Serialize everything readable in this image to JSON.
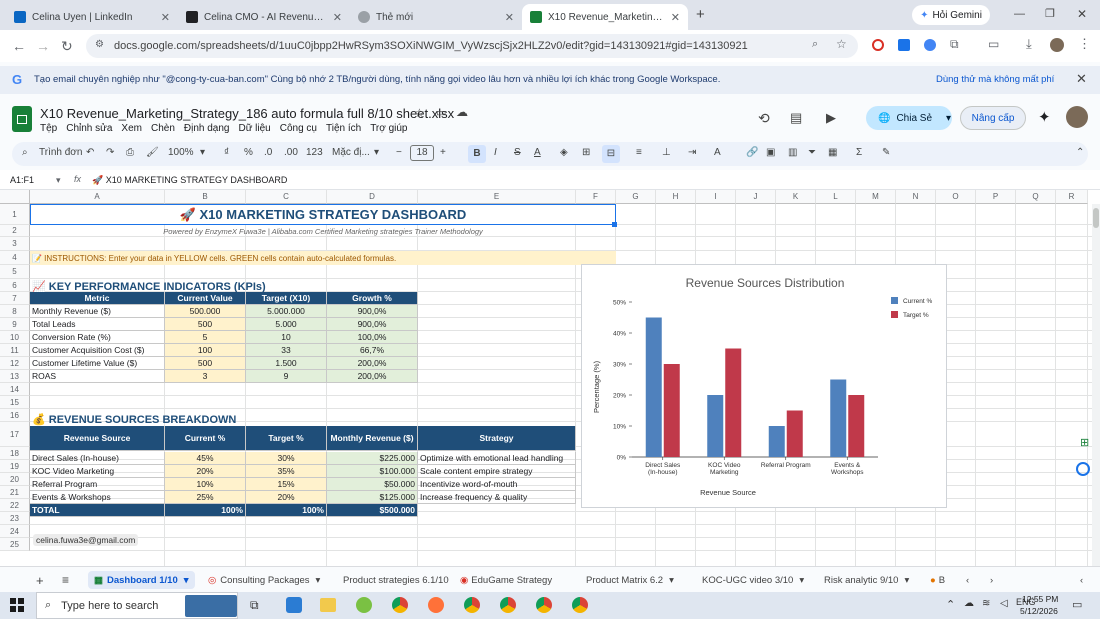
{
  "browser": {
    "tabs": [
      {
        "title": "Celina Uyen | LinkedIn",
        "color": "#0a66c2"
      },
      {
        "title": "Celina CMO - AI Revenue AI | G",
        "color": "#202124"
      },
      {
        "title": "Thẻ mới",
        "color": "#5f6368"
      },
      {
        "title": "X10 Revenue_Marketing_Strate",
        "color": "#188038"
      }
    ],
    "new_tab": "+",
    "gemini_label": "Hỏi Gemini",
    "url": "docs.google.com/spreadsheets/d/1uuC0jbpp2HwRSym3SOXiNWGIM_VyWzscjSjx2HLZ2v0/edit?gid=143130921#gid=143130921"
  },
  "promo": {
    "text": "Tạo email chuyên nghiệp như \"@cong-ty-cua-ban.com\" Cùng bộ nhớ 2 TB/người dùng, tính năng gọi video lâu hơn và nhiều lợi ích khác trong Google Workspace.",
    "cta": "Dùng thử mà không mất phí"
  },
  "doc": {
    "title": "X10 Revenue_Marketing_Strategy_186 auto formula full 8/10 sheet.xlsx",
    "menus": [
      "Tệp",
      "Chỉnh sửa",
      "Xem",
      "Chèn",
      "Định dạng",
      "Dữ liệu",
      "Công cụ",
      "Tiện ích",
      "Trợ giúp"
    ],
    "share_label": "Chia Sẻ",
    "upgrade_label": "Nâng cấp"
  },
  "toolbar": {
    "search": "Trình đơn",
    "zoom": "100%",
    "currency": "₫",
    "percent": "%",
    "dec_less": ".0",
    "dec_more": ".00",
    "numfmt": "123",
    "font": "Mặc đị...",
    "font_size": "18"
  },
  "formula_bar": {
    "cell_ref": "A1:F1",
    "fx": "fx",
    "content": "🚀 X10 MARKETING STRATEGY DASHBOARD"
  },
  "columns": [
    "A",
    "B",
    "C",
    "D",
    "E",
    "F",
    "G",
    "H",
    "I",
    "J",
    "K",
    "L",
    "M",
    "N",
    "O",
    "P",
    "Q",
    "R"
  ],
  "rows": [
    "1",
    "2",
    "3",
    "4",
    "5",
    "6",
    "7",
    "8",
    "9",
    "10",
    "11",
    "12",
    "13",
    "14",
    "15",
    "16",
    "17",
    "18",
    "19",
    "20",
    "21",
    "22",
    "23",
    "24",
    "25"
  ],
  "sheet": {
    "title": "🚀 X10 MARKETING STRATEGY DASHBOARD",
    "subtitle": "Powered by EnzymeX Fuwa3e | Alibaba.com Certified Marketing strategies Trainer Methodology",
    "instructions": "📝 INSTRUCTIONS: Enter your data in YELLOW cells. GREEN cells contain auto-calculated formulas.",
    "kpi_title": "📈 KEY PERFORMANCE INDICATORS (KPIs)",
    "kpi_headers": [
      "Metric",
      "Current Value",
      "Target (X10)",
      "Growth %"
    ],
    "kpi_rows": [
      [
        "Monthly Revenue ($)",
        "500.000",
        "5.000.000",
        "900,0%"
      ],
      [
        "Total Leads",
        "500",
        "5.000",
        "900,0%"
      ],
      [
        "Conversion Rate (%)",
        "5",
        "10",
        "100,0%"
      ],
      [
        "Customer Acquisition Cost ($)",
        "100",
        "33",
        "66,7%"
      ],
      [
        "Customer Lifetime Value ($)",
        "500",
        "1.500",
        "200,0%"
      ],
      [
        "ROAS",
        "3",
        "9",
        "200,0%"
      ]
    ],
    "rev_title": "💰 REVENUE SOURCES BREAKDOWN",
    "rev_headers": [
      "Revenue Source",
      "Current %",
      "Target %",
      "Monthly Revenue ($)",
      "Strategy"
    ],
    "rev_rows": [
      [
        "Direct Sales (In-house)",
        "45%",
        "30%",
        "$225.000",
        "Optimize with emotional lead handling"
      ],
      [
        "KOC Video Marketing",
        "20%",
        "35%",
        "$100.000",
        "Scale content empire strategy"
      ],
      [
        "Referral Program",
        "10%",
        "15%",
        "$50.000",
        "Incentivize word-of-mouth"
      ],
      [
        "Events & Workshops",
        "25%",
        "20%",
        "$125.000",
        "Increase frequency & quality"
      ]
    ],
    "total_row": [
      "TOTAL",
      "100%",
      "100%",
      "$500.000"
    ],
    "email": "celina.fuwa3e@gmail.com"
  },
  "chart_data": {
    "type": "bar",
    "title": "Revenue Sources Distribution",
    "xlabel": "Revenue Source",
    "ylabel": "Percentage (%)",
    "categories": [
      "Direct Sales (In-house)",
      "KOC Video Marketing",
      "Referral Program",
      "Events & Workshops"
    ],
    "series": [
      {
        "name": "Current %",
        "values": [
          45,
          20,
          10,
          25
        ],
        "color": "#4f81bd"
      },
      {
        "name": "Target %",
        "values": [
          30,
          35,
          15,
          20
        ],
        "color": "#c0394a"
      }
    ],
    "ylim": [
      0,
      50
    ],
    "yticks": [
      "0%",
      "10%",
      "20%",
      "30%",
      "40%",
      "50%"
    ],
    "legend": "right",
    "grid": false
  },
  "sheet_tabs": [
    "Dashboard 1/10",
    "Consulting Packages",
    "Product strategies 6.1/10",
    "EduGame Strategy",
    "Product Matrix 6.2",
    "KOC-UGC video 3/10",
    "Risk analytic 9/10",
    "B"
  ],
  "taskbar": {
    "search": "Type here to search",
    "time": "12:55 PM",
    "date": "5/12/2026"
  }
}
